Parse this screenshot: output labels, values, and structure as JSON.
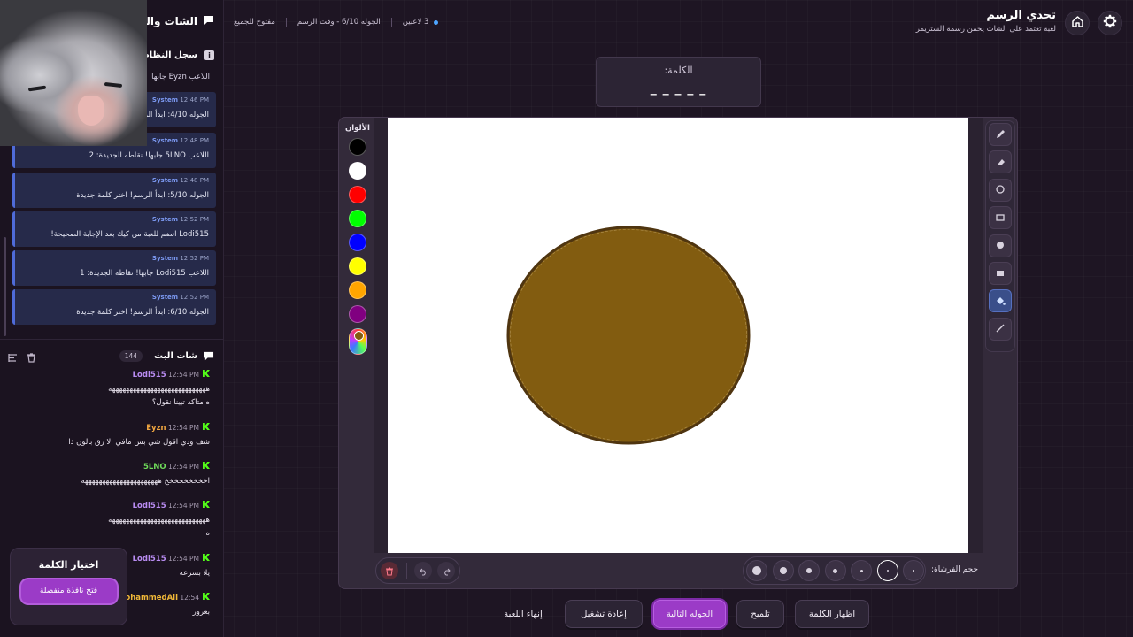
{
  "header": {
    "title": "تحدي الرسم",
    "subtitle": "لعبة تعتمد على الشات يخمن رسمة الستريمر",
    "status": {
      "players": "3 لاعبين",
      "round": "الجوله 6/10 - وقت الرسم",
      "mode": "مفتوح للجميع"
    }
  },
  "left_panel": {
    "title": "الشات والس",
    "system_log": {
      "title": "سجل النظام",
      "first_msg": "اللاعب Eyzn جابها!",
      "messages": [
        {
          "sender": "System",
          "time": "12:46 PM",
          "text": "الجوله 4/10: ابدأ الرس"
        },
        {
          "sender": "System",
          "time": "12:48 PM",
          "text": "اللاعب 5LNO جابها! نقاطه الجديدة: 2"
        },
        {
          "sender": "System",
          "time": "12:48 PM",
          "text": "الجوله 5/10: ابدأ الرسم! اختر كلمة جديدة"
        },
        {
          "sender": "System",
          "time": "12:52 PM",
          "text": "Lodi515 انضم للعبة من كيك بعد الإجابة الصحيحة!"
        },
        {
          "sender": "System",
          "time": "12:52 PM",
          "text": "اللاعب Lodi515 جابها! نقاطه الجديدة: 1"
        },
        {
          "sender": "System",
          "time": "12:52 PM",
          "text": "الجوله 6/10: ابدأ الرسم! اختر كلمة جديدة"
        }
      ]
    },
    "stream_chat": {
      "title": "شات البث",
      "count": "144",
      "messages": [
        {
          "user": "Lodi515",
          "time": "12:54 PM",
          "text": "ههههههههههههههههههههههههههههه",
          "color": "#b98cf2"
        },
        {
          "user": "",
          "time": "",
          "text": "ه متاكد تبينا نقول؟",
          "color": "#b98cf2"
        },
        {
          "user": "Eyzn",
          "time": "12:54 PM",
          "text": "شف ودي اقول شي بس مافي الا زق بالون ذا",
          "color": "#f0a640"
        },
        {
          "user": "5LNO",
          "time": "12:54 PM",
          "text": "اخخخخخخخخخ ههههههههههههههههههههههه",
          "color": "#6fdc5a"
        },
        {
          "user": "Lodi515",
          "time": "12:54 PM",
          "text": "ههههههههههههههههههههههههههههه",
          "color": "#b98cf2"
        },
        {
          "user": "",
          "time": "",
          "text": "ه",
          "color": "#b98cf2"
        },
        {
          "user": "Lodi515",
          "time": "12:54 PM",
          "text": "يلا بسرعه",
          "color": "#b98cf2"
        },
        {
          "user": "IMohammedAli",
          "time": "12:54",
          "text": "بعرور",
          "color": "#f0b838"
        }
      ]
    }
  },
  "word_picker": {
    "title": "اختيار الكلمة",
    "button": "فتح نافذة منفصلة"
  },
  "word_card": {
    "label": "الكلمة:",
    "hint": "_ _ _ _ _"
  },
  "palette": {
    "title": "الألوان",
    "colors": [
      "#000000",
      "#ffffff",
      "#ff0000",
      "#00ff00",
      "#0000ff",
      "#ffff00",
      "#ffa500",
      "#800080"
    ],
    "current_color": "#825c10"
  },
  "tools": [
    "pencil-icon",
    "eraser-icon",
    "circle-outline-icon",
    "rectangle-outline-icon",
    "circle-fill-icon",
    "rectangle-fill-icon",
    "fill-bucket-icon",
    "line-icon"
  ],
  "active_tool": "fill-bucket-icon",
  "brush_size_label": "حجم الفرشاة:",
  "canvas_drawing": {
    "shape": "ellipse",
    "fill": "#825c10",
    "stroke": "#4f3510"
  },
  "bottom_buttons": {
    "show_word": "اظهار الكلمة",
    "hint": "تلميح",
    "next_round": "الجوله التالية",
    "restart": "إعادة تشغيل",
    "end_game": "إنهاء اللعبة"
  }
}
